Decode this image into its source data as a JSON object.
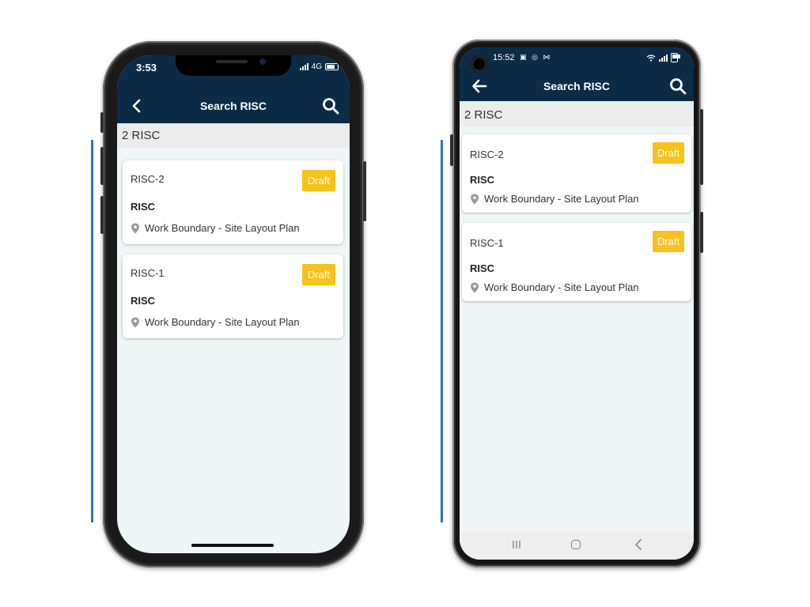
{
  "iphone": {
    "status": {
      "time": "3:53",
      "network": "4G"
    },
    "nav": {
      "title": "Search RISC"
    },
    "count_label": "2 RISC",
    "cards": [
      {
        "id": "RISC-2",
        "badge": "Draft",
        "type": "RISC",
        "location": "Work Boundary - Site Layout Plan"
      },
      {
        "id": "RISC-1",
        "badge": "Draft",
        "type": "RISC",
        "location": "Work Boundary - Site Layout Plan"
      }
    ]
  },
  "android": {
    "status": {
      "time": "15:52"
    },
    "nav": {
      "title": "Search RISC"
    },
    "count_label": "2 RISC",
    "cards": [
      {
        "id": "RISC-2",
        "badge": "Draft",
        "type": "RISC",
        "location": "Work Boundary - Site Layout Plan"
      },
      {
        "id": "RISC-1",
        "badge": "Draft",
        "type": "RISC",
        "location": "Work Boundary - Site Layout Plan"
      }
    ]
  },
  "colors": {
    "header": "#0b2b46",
    "badge": "#f6c21c",
    "background": "#eef7f5",
    "accent_line": "#2b74b8"
  }
}
